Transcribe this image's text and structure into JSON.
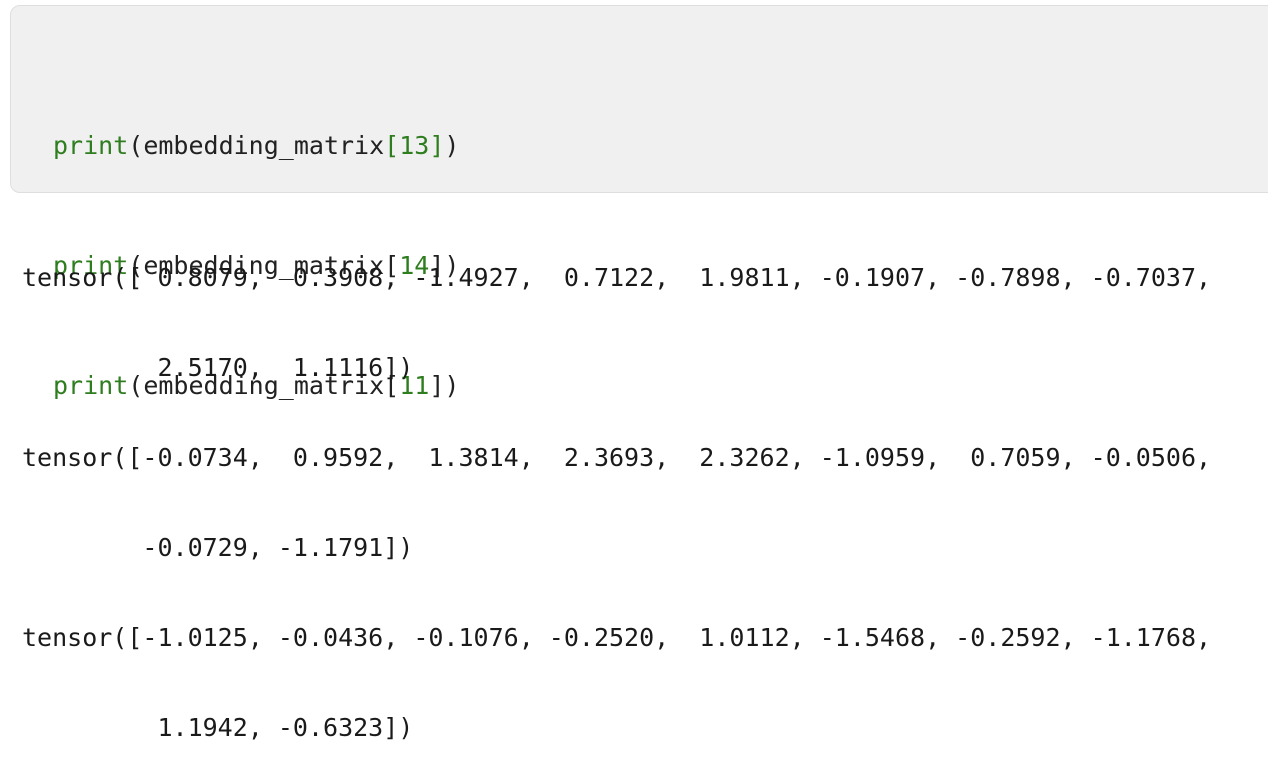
{
  "cell": {
    "lines": [
      {
        "func": "print",
        "open": "(",
        "arg": "embedding_matrix",
        "lbr": "[",
        "index": "13",
        "rbr": "]",
        "close": ")"
      },
      {
        "func": "print",
        "open": "(",
        "arg": "embedding_matrix",
        "lbr": "[",
        "index": "14",
        "rbr": "]",
        "close": ")"
      },
      {
        "func": "print",
        "open": "(",
        "arg": "embedding_matrix",
        "lbr": "[",
        "index": "11",
        "rbr": "]",
        "close": ")"
      }
    ]
  },
  "output": {
    "lines": [
      "tensor([ 0.8079,  0.3908, -1.4927,  0.7122,  1.9811, -0.1907, -0.7898, -0.7037,",
      "         2.5170,  1.1116])",
      "tensor([-0.0734,  0.9592,  1.3814,  2.3693,  2.3262, -1.0959,  0.7059, -0.0506,",
      "        -0.0729, -1.1791])",
      "tensor([-1.0125, -0.0436, -0.1076, -0.2520,  1.0112, -1.5468, -0.2592, -1.1768,",
      "         1.1942, -0.6323])"
    ]
  },
  "colors": {
    "keyword": "#2e7d1f",
    "number": "#2e7d1f",
    "cell_background": "#f0f0f0"
  }
}
